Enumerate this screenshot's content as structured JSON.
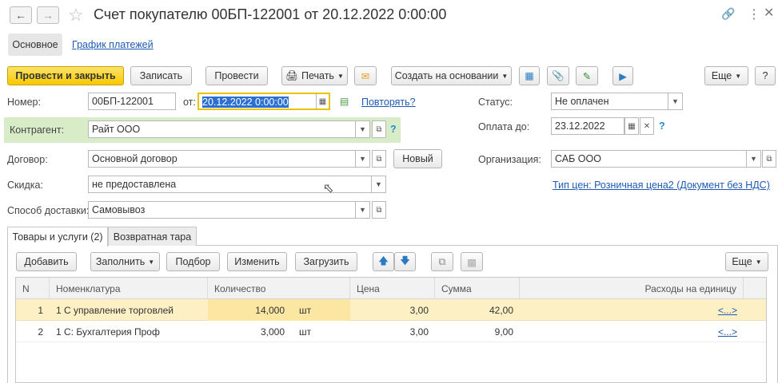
{
  "window": {
    "title": "Счет покупателю 00БП-122001 от 20.12.2022 0:00:00"
  },
  "top_tabs": [
    "Основное",
    "График платежей"
  ],
  "toolbar": {
    "post_close": "Провести и закрыть",
    "save": "Записать",
    "post": "Провести",
    "print": "Печать",
    "create_based": "Создать на основании",
    "more": "Еще",
    "help": "?"
  },
  "form": {
    "number_label": "Номер:",
    "number_value": "00БП-122001",
    "date_label": "от:",
    "date_value": "20.12.2022  0:00:00",
    "repeat_link": "Повторять?",
    "status_label": "Статус:",
    "status_value": "Не оплачен",
    "counterparty_label": "Контрагент:",
    "counterparty_value": "Райт ООО",
    "payment_label": "Оплата до:",
    "payment_value": "23.12.2022",
    "contract_label": "Договор:",
    "contract_value": "Основной договор",
    "new_button": "Новый",
    "org_label": "Организация:",
    "org_value": "САБ ООО",
    "discount_label": "Скидка:",
    "discount_value": "не предоставлена",
    "price_type_link": "Тип цен: Розничная цена2 (Документ без НДС)",
    "delivery_label": "Способ доставки:",
    "delivery_value": "Самовывоз"
  },
  "tabs": {
    "goods": "Товары и услуги (2)",
    "returnable": "Возвратная тара"
  },
  "table_toolbar": {
    "add": "Добавить",
    "fill": "Заполнить",
    "select": "Подбор",
    "edit": "Изменить",
    "load": "Загрузить",
    "more": "Еще"
  },
  "table": {
    "columns": [
      "N",
      "Номенклатура",
      "Количество",
      "Цена",
      "Сумма",
      "Расходы на единицу"
    ],
    "rows": [
      {
        "n": "1",
        "name": "1 С управление торговлей",
        "qty": "14,000",
        "unit": "шт",
        "price": "3,00",
        "sum": "42,00",
        "expense": "<...>"
      },
      {
        "n": "2",
        "name": "1 С:  Бухгалтерия Проф",
        "qty": "3,000",
        "unit": "шт",
        "price": "3,00",
        "sum": "9,00",
        "expense": "<...>"
      }
    ]
  },
  "colors": {
    "accent_yellow": "#f7c900",
    "row_highlight": "#fdf0c4",
    "counterparty_bg": "#d9ecc8",
    "link": "#1f5bb5"
  }
}
